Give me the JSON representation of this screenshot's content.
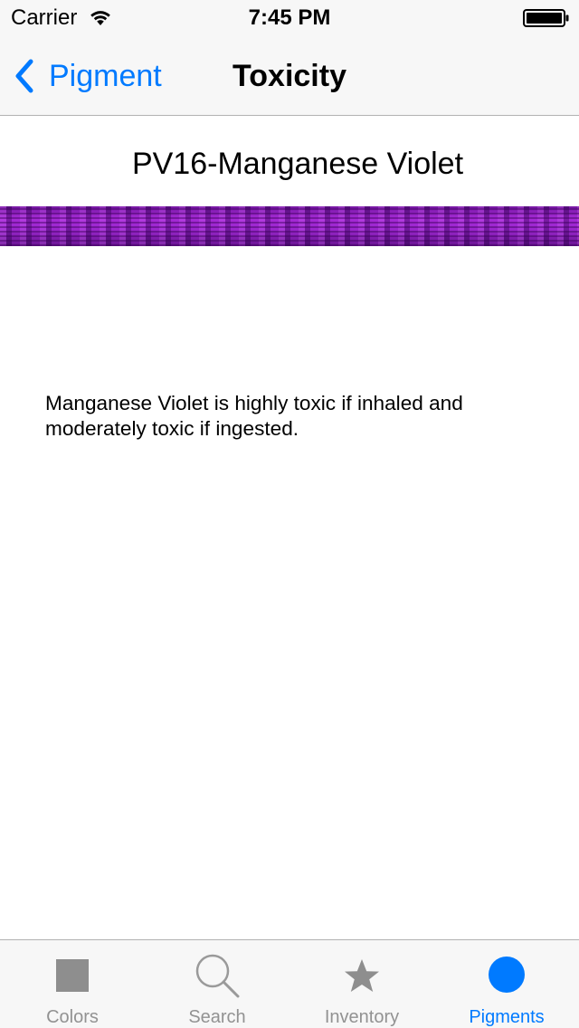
{
  "status_bar": {
    "carrier": "Carrier",
    "time": "7:45 PM",
    "wifi_icon": "wifi-icon",
    "battery_icon": "battery-icon"
  },
  "nav": {
    "back_label": "Pigment",
    "title": "Toxicity"
  },
  "pigment": {
    "name": "PV16-Manganese Violet",
    "swatch_color": "#8f1fc0",
    "toxicity": "Manganese Violet is highly toxic if inhaled and moderately toxic if ingested."
  },
  "tabs": [
    {
      "label": "Colors",
      "icon": "square-icon",
      "active": false
    },
    {
      "label": "Search",
      "icon": "search-icon",
      "active": false
    },
    {
      "label": "Inventory",
      "icon": "star-icon",
      "active": false
    },
    {
      "label": "Pigments",
      "icon": "circle-icon",
      "active": true
    }
  ],
  "colors": {
    "accent": "#007aff",
    "inactive_tab": "#929292",
    "bar_background": "#f7f7f7"
  }
}
